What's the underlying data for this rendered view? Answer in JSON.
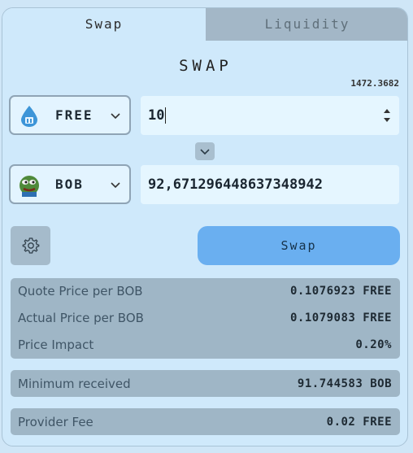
{
  "tabs": {
    "swap": "Swap",
    "liquidity": "Liquidity"
  },
  "title": "SWAP",
  "balance": "1472.3682",
  "from": {
    "token": "FREE",
    "icon": "water-drop-icon",
    "amount": "10"
  },
  "to": {
    "token": "BOB",
    "icon": "pepe-frog-icon",
    "amount": "92,671296448637348942"
  },
  "swap_button": "Swap",
  "stats": [
    {
      "label": "Quote Price per BOB",
      "value": "0.1076923 FREE"
    },
    {
      "label": "Actual Price per BOB",
      "value": "0.1079083 FREE"
    },
    {
      "label": "Price Impact",
      "value": "0.20%"
    }
  ],
  "minimum": {
    "label": "Minimum received",
    "value": "91.744583 BOB"
  },
  "fee": {
    "label": "Provider Fee",
    "value": "0.02 FREE"
  },
  "colors": {
    "accent": "#6aaff0",
    "panel": "#9fb6c6",
    "background": "#cfe9fb"
  }
}
